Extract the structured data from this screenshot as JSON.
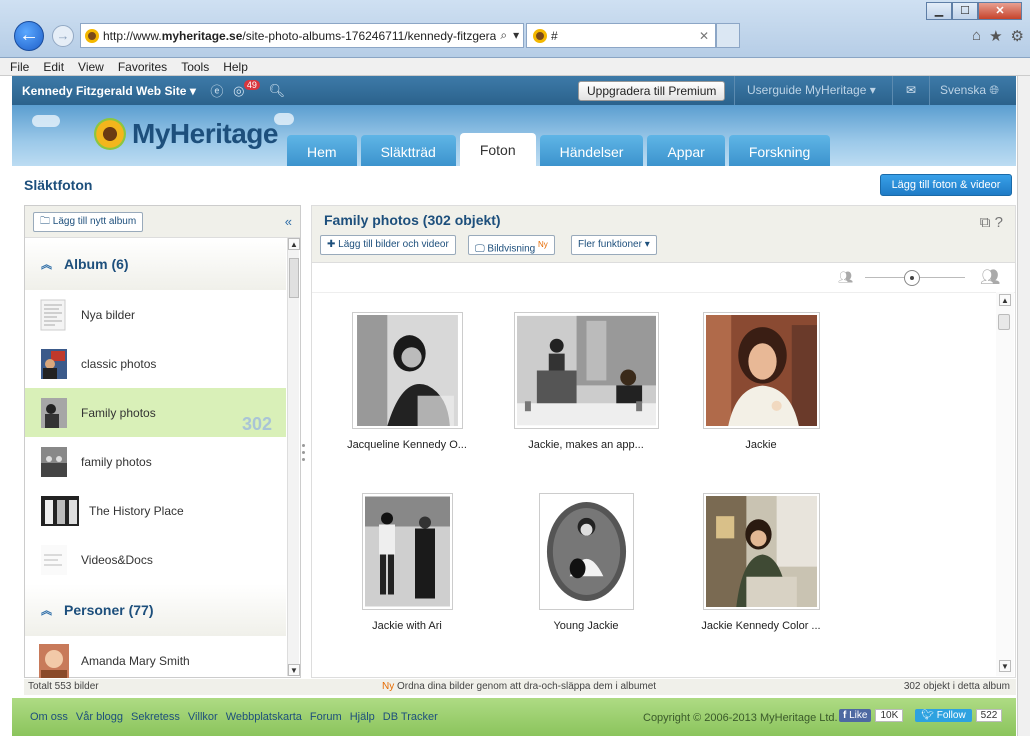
{
  "browser": {
    "url": "http://www.myheritage.se/site-photo-albums-176246711/kennedy-fitzgera",
    "url_domain_bold": "myheritage.se",
    "tab_title": "#",
    "menu": [
      "File",
      "Edit",
      "View",
      "Favorites",
      "Tools",
      "Help"
    ]
  },
  "topbar": {
    "site_name": "Kennedy Fitzgerald Web Site",
    "notification_count": "49",
    "upgrade_label": "Uppgradera till Premium",
    "userguide_label": "Userguide MyHeritage",
    "language_label": "Svenska"
  },
  "header": {
    "logo_text": "MyHeritage",
    "tabs": [
      "Hem",
      "Släktträd",
      "Foton",
      "Händelser",
      "Appar",
      "Forskning"
    ],
    "active_tab": "Foton"
  },
  "page": {
    "title": "Släktfoton",
    "add_media_label": "Lägg till foton & videor"
  },
  "left": {
    "new_album_label": "Lägg till nytt album",
    "album_section": "Album (6)",
    "albums": [
      {
        "name": "Nya bilder"
      },
      {
        "name": "classic photos"
      },
      {
        "name": "Family photos",
        "count": "302"
      },
      {
        "name": "family photos"
      },
      {
        "name": "The History Place"
      },
      {
        "name": "Videos&Docs"
      }
    ],
    "people_section": "Personer (77)",
    "people": [
      {
        "name": "Amanda Mary Smith"
      }
    ]
  },
  "right": {
    "album_title": "Family photos (302 objekt)",
    "add_photos_label": "Lägg till bilder och videor",
    "slideshow_label": "Bildvisning",
    "slideshow_new": "Ny",
    "more_label": "Fler funktioner",
    "photos": [
      {
        "caption": "Jacqueline Kennedy O..."
      },
      {
        "caption": "Jackie, makes an app..."
      },
      {
        "caption": "Jackie"
      },
      {
        "caption": "Jackie with Ari"
      },
      {
        "caption": "Young Jackie"
      },
      {
        "caption": "Jackie Kennedy Color ..."
      }
    ]
  },
  "status": {
    "total": "Totalt 553 bilder",
    "tip_new": "Ny",
    "tip_text": "Ordna dina bilder genom att dra-och-släppa dem i albumet",
    "object_count": "302 objekt i detta album"
  },
  "footer": {
    "links": [
      "Om oss",
      "Vår blogg",
      "Sekretess",
      "Villkor",
      "Webbplatskarta",
      "Forum",
      "Hjälp",
      "DB Tracker"
    ],
    "copyright": "Copyright © 2006-2013 MyHeritage Ltd.",
    "like_label": "Like",
    "like_count": "10K",
    "follow_label": "Follow",
    "follow_count": "522"
  },
  "colors": {
    "brand_blue": "#1d4f7c",
    "topbar": "#2b628c",
    "selected_album": "#d9f0b8",
    "footer_green": "#9fd072",
    "accent_orange": "#f08a00"
  }
}
